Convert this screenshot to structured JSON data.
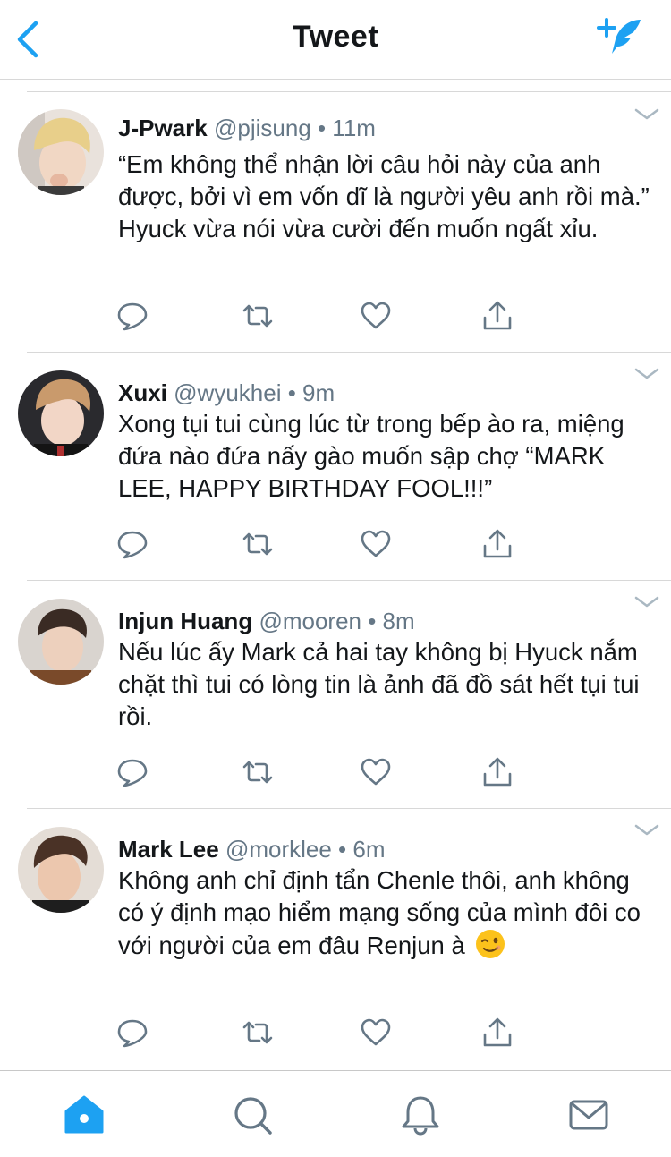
{
  "header": {
    "title": "Tweet",
    "back_icon": "chevron-left-icon",
    "compose_icon": "compose-tweet-icon",
    "accent_color": "#1da1f2"
  },
  "tweets": [
    {
      "name": "J-Pwark",
      "meta": "@pjisung • 11m",
      "text": "“Em không thể nhận lời câu hỏi này của anh được, bởi vì em vốn dĩ là người yêu anh rồi mà.” Hyuck vừa nói vừa cười đến muốn ngất xỉu."
    },
    {
      "name": "Xuxi",
      "meta": "@wyukhei • 9m",
      "text": "Xong tụi tui cùng lúc từ trong bếp ào ra, miệng đứa nào đứa nấy gào muốn sập chợ “MARK LEE, HAPPY BIRTHDAY FOOL!!!”"
    },
    {
      "name": "Injun Huang",
      "meta": "@mooren • 8m",
      "text": "Nếu lúc ấy Mark cả hai tay không bị Hyuck nắm chặt thì tui có lòng tin là ảnh đã đồ sát hết tụi tui rồi."
    },
    {
      "name": "Mark Lee",
      "meta": "@morklee • 6m",
      "text": "Không anh chỉ định tẩn Chenle thôi, anh không có ý định mạo hiểm mạng sống của mình đôi co với người của em đâu Renjun à",
      "emoji": "winking-face-emoji"
    }
  ],
  "tabbar": {
    "items": [
      "home-icon",
      "search-icon",
      "notifications-bell-icon",
      "messages-envelope-icon"
    ],
    "active": "home-icon",
    "active_color": "#1da1f2",
    "inactive_color": "#657786"
  }
}
